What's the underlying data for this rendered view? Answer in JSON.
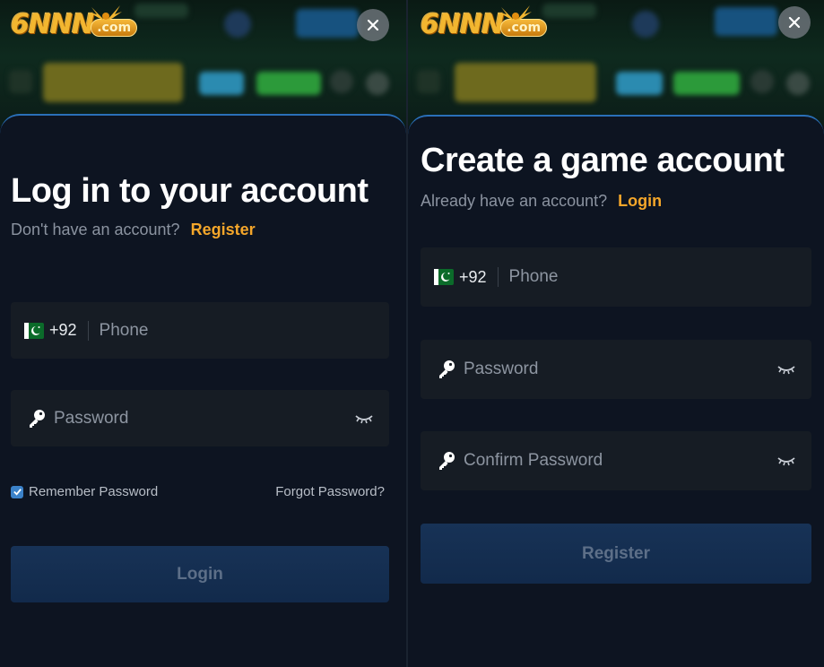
{
  "login": {
    "title": "Log in to your account",
    "subtitle_text": "Don't have an account?",
    "subtitle_link": "Register",
    "phone_code": "+92",
    "phone_placeholder": "Phone",
    "password_placeholder": "Password",
    "remember_label": "Remember Password",
    "remember_checked": true,
    "forgot_label": "Forgot Password?",
    "submit_label": "Login"
  },
  "register": {
    "title": "Create a game account",
    "subtitle_text": "Already have an account?",
    "subtitle_link": "Login",
    "phone_code": "+92",
    "phone_placeholder": "Phone",
    "password_placeholder": "Password",
    "confirm_placeholder": "Confirm Password",
    "submit_label": "Register"
  },
  "brand": {
    "logo_main": "6NNN",
    "logo_suffix": ".com"
  },
  "icons": {
    "close": "close-icon",
    "flag": "pakistan-flag-icon",
    "key": "key-icon",
    "eye": "eye-closed-icon"
  },
  "colors": {
    "accent_link": "#f4a62a",
    "sheet_border": "#2a6fb8",
    "button_bg": "#173256",
    "checkbox": "#3b82c9"
  }
}
